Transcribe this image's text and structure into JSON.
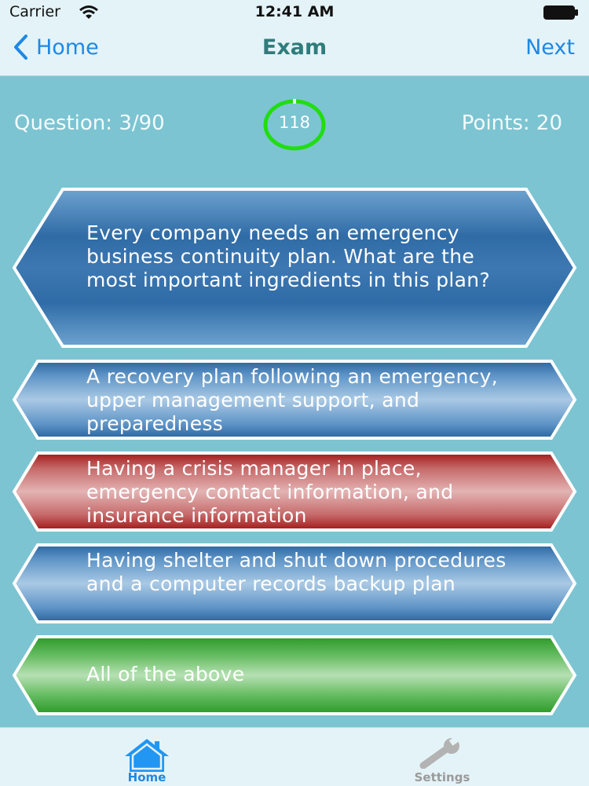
{
  "status_bar": {
    "carrier": "Carrier",
    "time": "12:41 AM"
  },
  "nav": {
    "back_label": "Home",
    "title": "Exam",
    "next_label": "Next"
  },
  "info": {
    "question": "Question: 3/90",
    "timer": "118",
    "points": "Points: 20"
  },
  "question_text": "Every company needs an emergency business continuity plan. What are the most important ingredients in this plan?",
  "answers": [
    {
      "text": "A recovery plan following an emergency, upper management support, and preparedness",
      "state": "default"
    },
    {
      "text": "Having a crisis manager in place, emergency contact information, and insurance information",
      "state": "incorrect"
    },
    {
      "text": "Having shelter and shut down procedures and a computer records backup plan",
      "state": "default"
    },
    {
      "text": "All of the above",
      "state": "correct"
    }
  ],
  "tabs": [
    {
      "label": "Home",
      "icon": "house-icon",
      "active": true
    },
    {
      "label": "Settings",
      "icon": "wrench-icon",
      "active": false
    }
  ],
  "colors": {
    "background": "#7cc4d2",
    "blue_panel": "#2e6ea8",
    "red_panel": "#a51d1d",
    "green_panel": "#32a02e",
    "accent": "#1e88e5",
    "timer_ring": "#22dd11"
  }
}
